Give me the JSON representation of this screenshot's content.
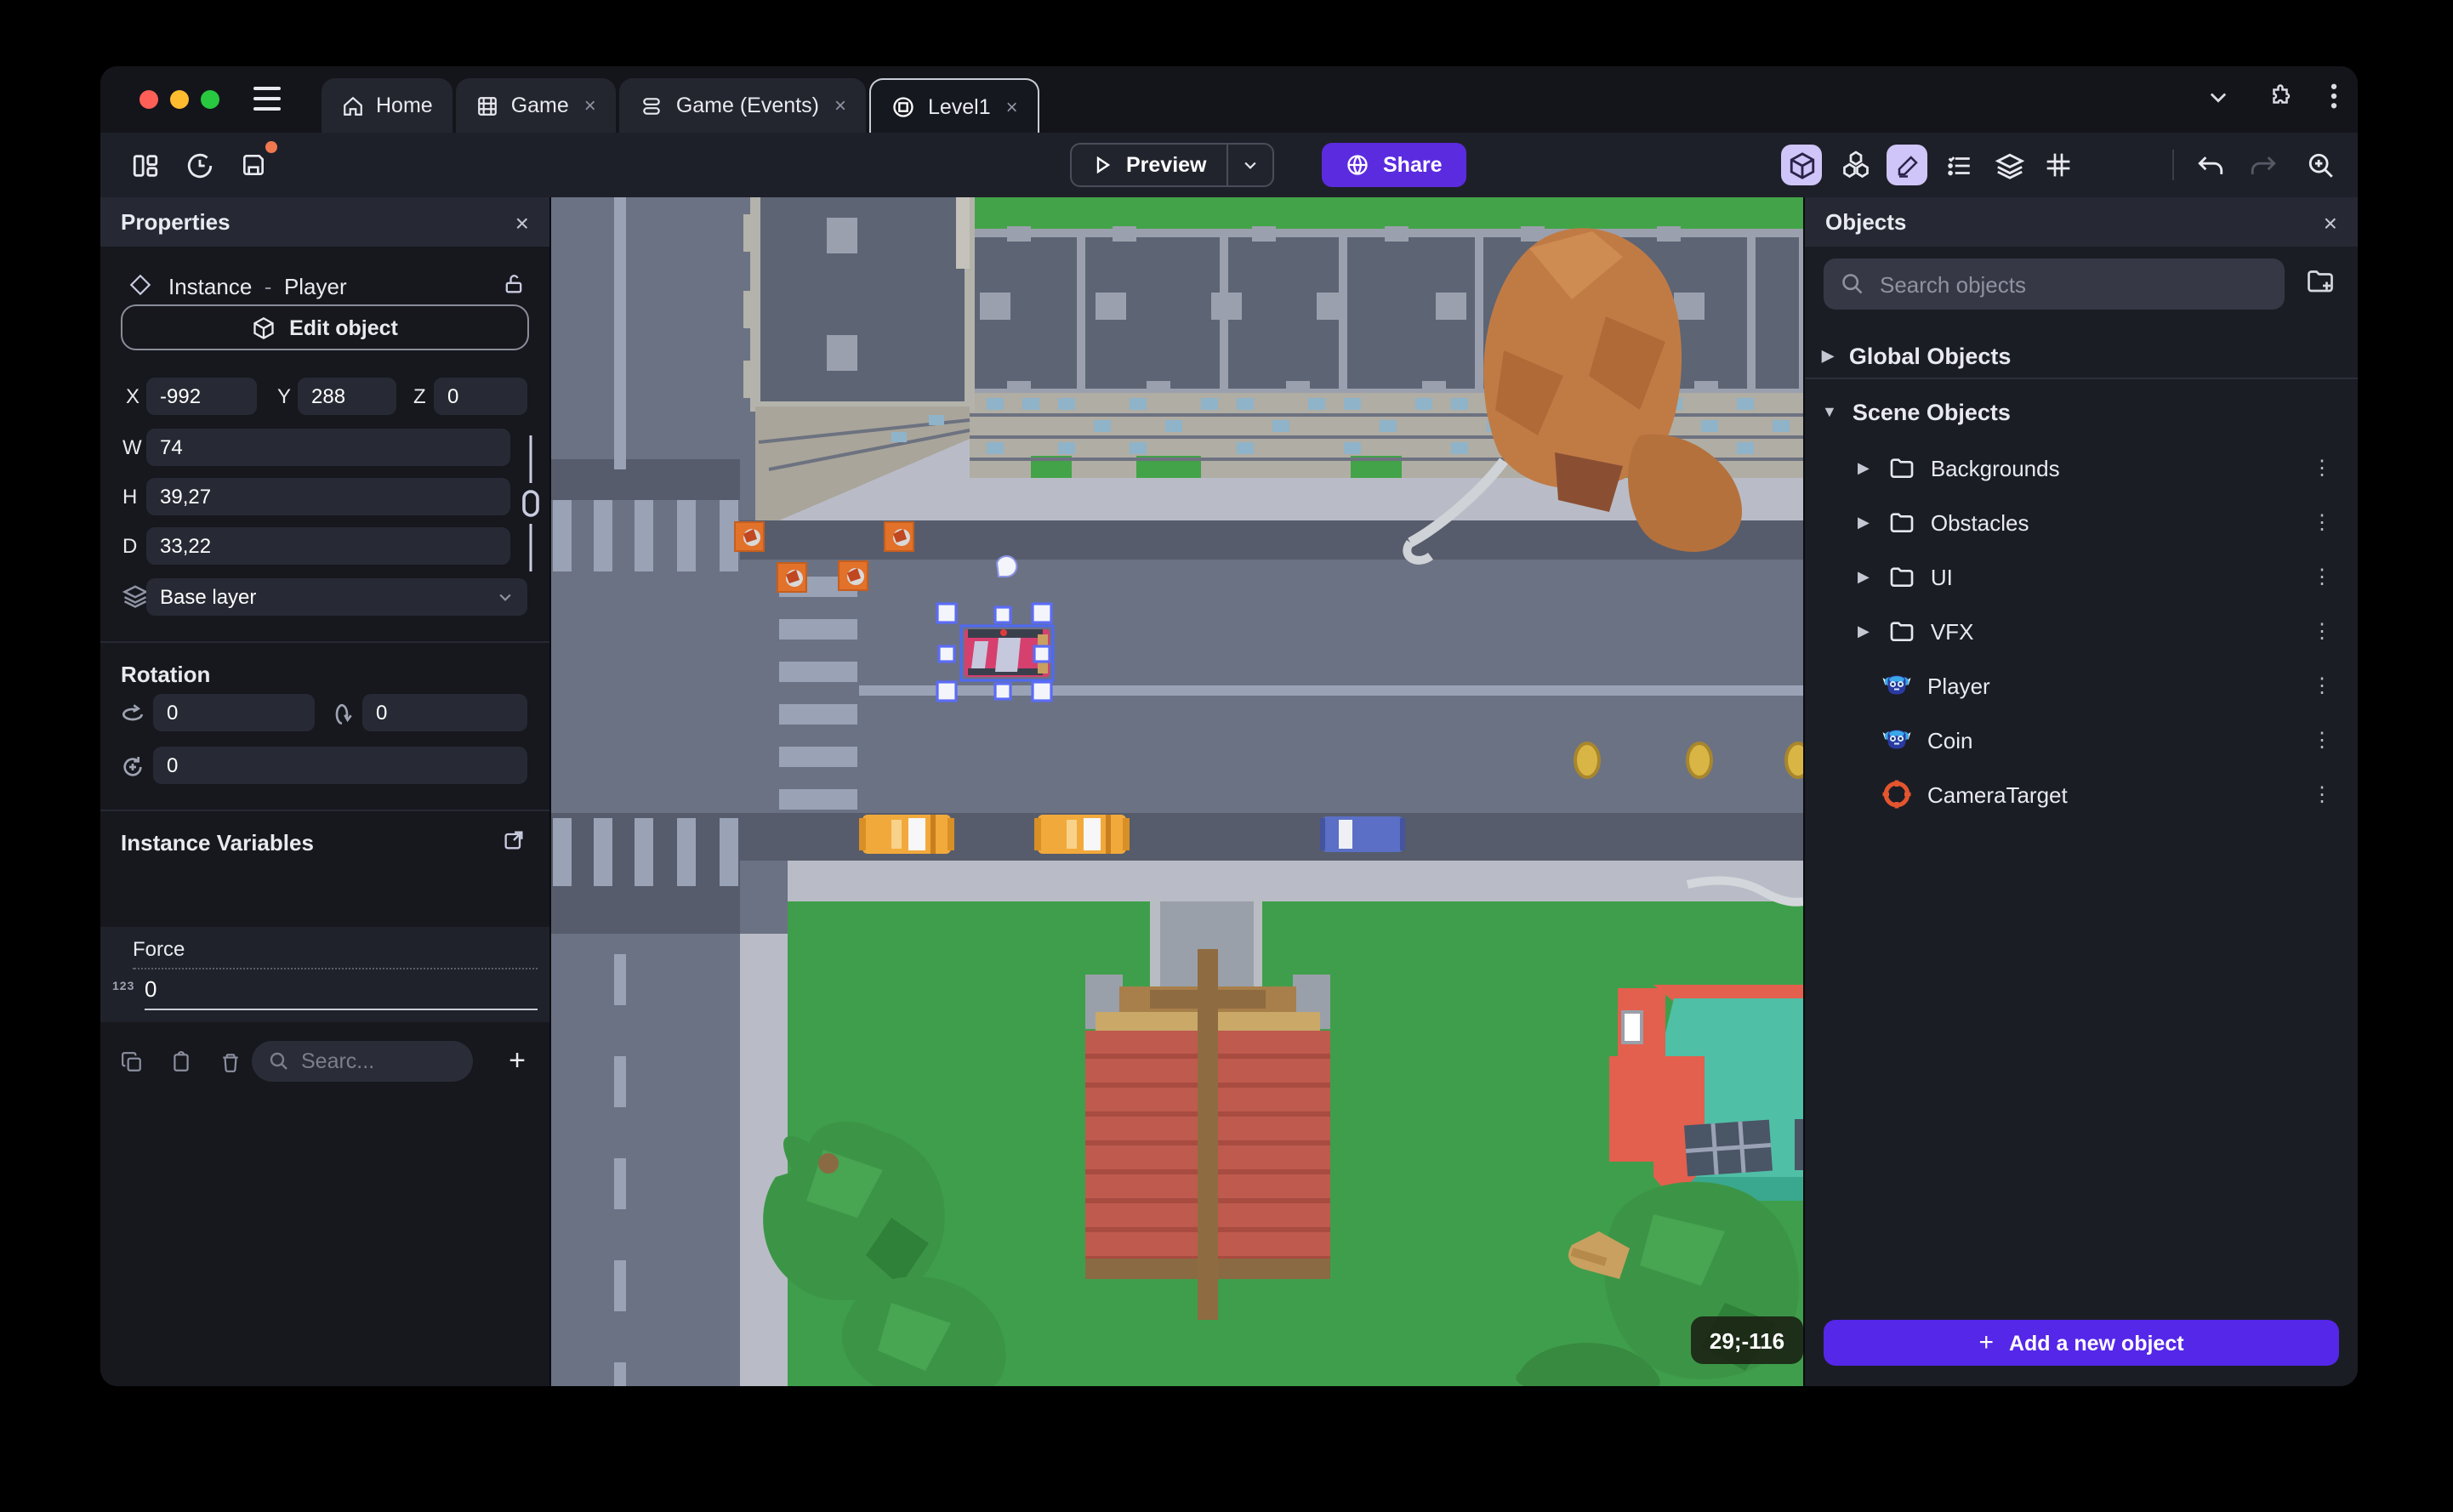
{
  "window": {
    "traffic_red": "#ff5f57",
    "traffic_yellow": "#febc2e",
    "traffic_green": "#28c840"
  },
  "tabs": [
    {
      "label": "Home",
      "closable": false
    },
    {
      "label": "Game",
      "closable": true,
      "close": "×"
    },
    {
      "label": "Game (Events)",
      "closable": true,
      "close": "×"
    },
    {
      "label": "Level1",
      "closable": true,
      "close": "×",
      "active": true
    }
  ],
  "toolbar": {
    "preview_label": "Preview",
    "share_label": "Share"
  },
  "properties": {
    "title": "Properties",
    "close": "×",
    "instance_label": "Instance",
    "separator": "-",
    "object_name": "Player",
    "edit_button": "Edit object",
    "x_label": "X",
    "x_value": "-992",
    "y_label": "Y",
    "y_value": "288",
    "z_label": "Z",
    "z_value": "0",
    "w_label": "W",
    "w_value": "74",
    "h_label": "H",
    "h_value": "39,27",
    "d_label": "D",
    "d_value": "33,22",
    "layer_value": "Base layer",
    "rotation_title": "Rotation",
    "rot_x_value": "0",
    "rot_y_value": "0",
    "rot_z_value": "0",
    "variables_title": "Instance Variables",
    "variable_name": "Force",
    "variable_type_icon": "123",
    "variable_value": "0",
    "search_placeholder": "Searc...",
    "add": "+"
  },
  "objects_panel": {
    "title": "Objects",
    "close": "×",
    "search_placeholder": "Search objects",
    "global_group": "Global Objects",
    "scene_group": "Scene Objects",
    "folders": [
      {
        "name": "Backgrounds"
      },
      {
        "name": "Obstacles"
      },
      {
        "name": "UI"
      },
      {
        "name": "VFX"
      }
    ],
    "items": [
      {
        "name": "Player",
        "icon": "monkey"
      },
      {
        "name": "Coin",
        "icon": "monkey"
      },
      {
        "name": "CameraTarget",
        "icon": "crosshair"
      }
    ],
    "add_button": "Add a new object",
    "kebab": "⋮"
  },
  "canvas": {
    "coordinates_badge": "29;-116"
  },
  "colors": {
    "accent": "#5b2be0",
    "accent_light": "#cfc5f8",
    "selection": "#5b6cf5"
  }
}
